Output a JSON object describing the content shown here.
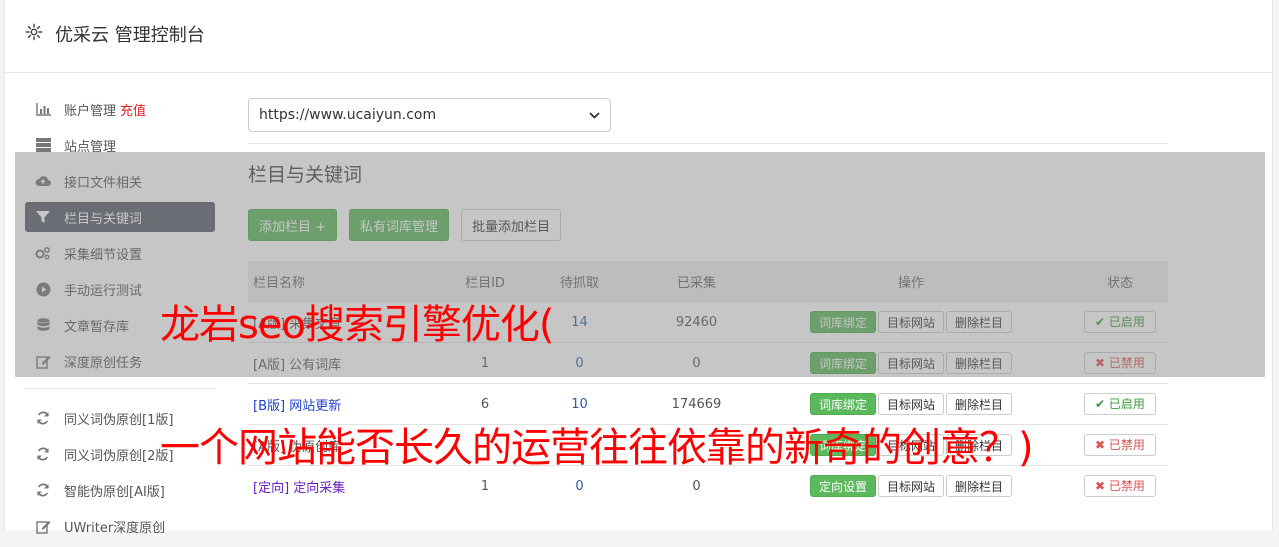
{
  "app": {
    "title": "优采云 管理控制台"
  },
  "sidebar": {
    "items": [
      {
        "label": "账户管理",
        "badge": "充值",
        "icon": "bar-chart-icon"
      },
      {
        "label": "站点管理",
        "icon": "server-icon"
      },
      {
        "label": "接口文件相关",
        "icon": "cloud-upload-icon"
      },
      {
        "label": "栏目与关键词",
        "icon": "filter-icon",
        "active": true
      },
      {
        "label": "采集细节设置",
        "icon": "cogs-icon"
      },
      {
        "label": "手动运行测试",
        "icon": "play-circle-icon"
      },
      {
        "label": "文章暂存库",
        "icon": "database-icon"
      },
      {
        "label": "深度原创任务",
        "icon": "edit-icon"
      }
    ],
    "items2": [
      {
        "label": "同义词伪原创[1版]",
        "icon": "refresh-icon"
      },
      {
        "label": "同义词伪原创[2版]",
        "icon": "refresh-icon"
      },
      {
        "label": "智能伪原创[AI版]",
        "icon": "refresh-icon"
      },
      {
        "label": "UWriter深度原创",
        "icon": "edit-icon"
      }
    ]
  },
  "main": {
    "site_select": "https://www.ucaiyun.com",
    "section_title": "栏目与关键词",
    "buttons": {
      "add_column": "添加栏目 +",
      "private_lib": "私有词库管理",
      "batch_add": "批量添加栏目"
    },
    "table": {
      "headers": [
        "栏目名称",
        "栏目ID",
        "待抓取",
        "已采集",
        "操作",
        "状态"
      ],
      "rows": [
        {
          "name": "[A版] 采集文章",
          "id": "",
          "pending": "14",
          "collected": "92460",
          "op1": "词库绑定",
          "op2": "目标网站",
          "op3": "删除栏目",
          "status": "已启用",
          "on": true
        },
        {
          "name": "[A版] 公有词库",
          "id": "1",
          "pending": "0",
          "collected": "0",
          "op1": "词库绑定",
          "op2": "目标网站",
          "op3": "删除栏目",
          "status": "已禁用",
          "on": false
        },
        {
          "name": "[B版] 网站更新",
          "id": "6",
          "pending": "10",
          "collected": "174669",
          "op1": "词库绑定",
          "op2": "目标网站",
          "op3": "删除栏目",
          "status": "已启用",
          "on": true
        },
        {
          "name": "[A版] 伪原创库",
          "id": "",
          "pending": "",
          "collected": "",
          "op1": "词库绑定",
          "op2": "目标网站",
          "op3": "删除栏目",
          "status": "已禁用",
          "on": false
        },
        {
          "name": "[定向] 定向采集",
          "id": "1",
          "pending": "0",
          "collected": "0",
          "op1": "定向设置",
          "op2": "目标网站",
          "op3": "删除栏目",
          "status": "已禁用",
          "on": false
        }
      ]
    }
  },
  "overlay": {
    "headline1": "龙岩seo搜索引擎优化(",
    "headline2": "一个网站能否长久的运营往往依靠的新奇的创意？)"
  }
}
